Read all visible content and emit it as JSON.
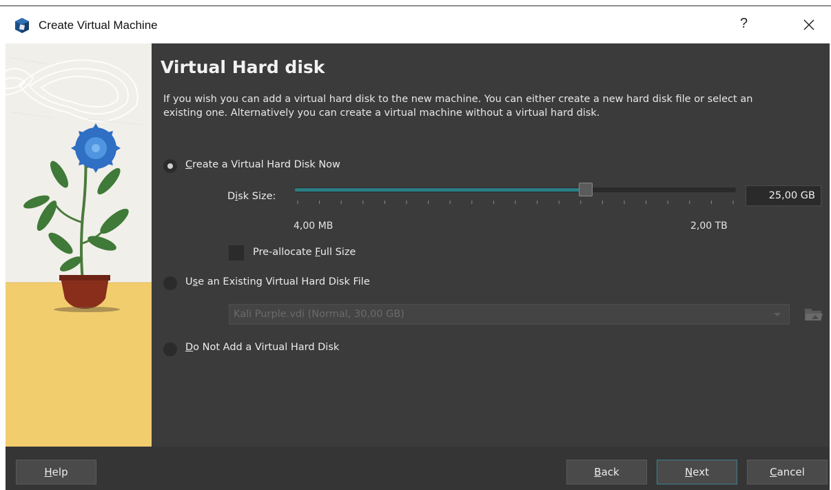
{
  "window": {
    "title": "Create Virtual Machine",
    "help_label": "?"
  },
  "page": {
    "heading": "Virtual Hard disk",
    "description": "If you wish you can add a virtual hard disk to the new machine. You can either create a new hard disk file or select an existing one. Alternatively you can create a virtual machine without a virtual hard disk."
  },
  "options": {
    "create_now": {
      "pre": "",
      "key": "C",
      "post": "reate a Virtual Hard Disk Now",
      "selected": true
    },
    "use_existing": {
      "pre": "U",
      "key": "s",
      "post": "e an Existing Virtual Hard Disk File",
      "selected": false
    },
    "do_not_add": {
      "pre": "",
      "key": "D",
      "post": "o Not Add a Virtual Hard Disk",
      "selected": false
    }
  },
  "disk_size": {
    "label_pre": "D",
    "label_key": "i",
    "label_post": "sk Size:",
    "value": "25,00 GB",
    "min_label": "4,00 MB",
    "max_label": "2,00 TB",
    "slider_position": 0.66
  },
  "preallocate": {
    "pre": "Pre-allocate ",
    "key": "F",
    "post": "ull Size",
    "checked": false
  },
  "existing_disk": {
    "selected": "Kali Purple.vdi (Normal, 30,00 GB)"
  },
  "buttons": {
    "help": {
      "key": "H",
      "post": "elp"
    },
    "back": {
      "key": "B",
      "post": "ack"
    },
    "next": {
      "key": "N",
      "post": "ext"
    },
    "cancel": {
      "key": "C",
      "post": "ancel"
    }
  },
  "colors": {
    "accent": "#2b7f86",
    "background": "#3b3b3b",
    "footer": "#353535"
  }
}
